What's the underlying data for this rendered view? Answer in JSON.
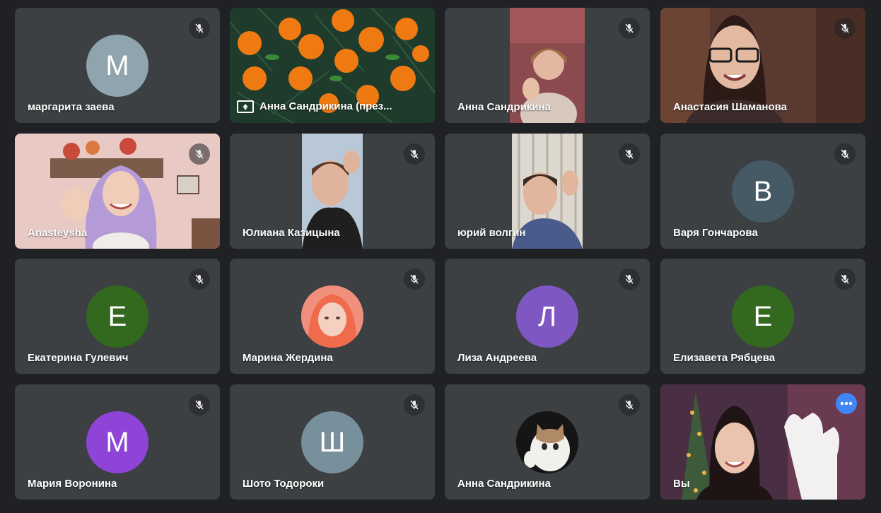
{
  "colors": {
    "background": "#202124",
    "tile": "#3c4043",
    "self_border": "#8ab4f8",
    "more_button": "#4285f4"
  },
  "participants": [
    {
      "name": "маргарита заева",
      "initial": "М",
      "avatar_color": "#90a4ae",
      "muted": true
    },
    {
      "name": "Анна Сандрикина (през...",
      "video": "tangerines-presentation",
      "presenting": true
    },
    {
      "name": "Анна Сандрикина",
      "video": "girl-waving",
      "muted": true
    },
    {
      "name": "Анастасия Шаманова",
      "video": "girl-glasses",
      "muted": true
    },
    {
      "name": "Anasteysha",
      "video": "girl-lilac-hair",
      "muted": true
    },
    {
      "name": "Юлиана Казицына",
      "video": "girl-waving-2",
      "muted": true
    },
    {
      "name": "юрий волгин",
      "video": "boy-waving",
      "muted": true
    },
    {
      "name": "Варя Гончарова",
      "initial": "В",
      "avatar_color": "#455a64",
      "muted": true
    },
    {
      "name": "Екатерина Гулевич",
      "initial": "Е",
      "avatar_color": "#33691e",
      "muted": true
    },
    {
      "name": "Марина Жердина",
      "avatar_photo": "pink-hair-portrait",
      "muted": true
    },
    {
      "name": "Лиза Андреева",
      "initial": "Л",
      "avatar_color": "#7e57c2",
      "muted": true
    },
    {
      "name": "Елизавета Рябцева",
      "initial": "Е",
      "avatar_color": "#33691e",
      "muted": true
    },
    {
      "name": "Мария Воронина",
      "initial": "М",
      "avatar_color": "#8e44d6",
      "muted": true
    },
    {
      "name": "Шото Тодороки",
      "initial": "Ш",
      "avatar_color": "#78909c",
      "muted": true
    },
    {
      "name": "Анна Сандрикина",
      "avatar_photo": "cat-photo",
      "muted": true
    },
    {
      "name": "Вы",
      "video": "self-waving",
      "self": true
    }
  ]
}
